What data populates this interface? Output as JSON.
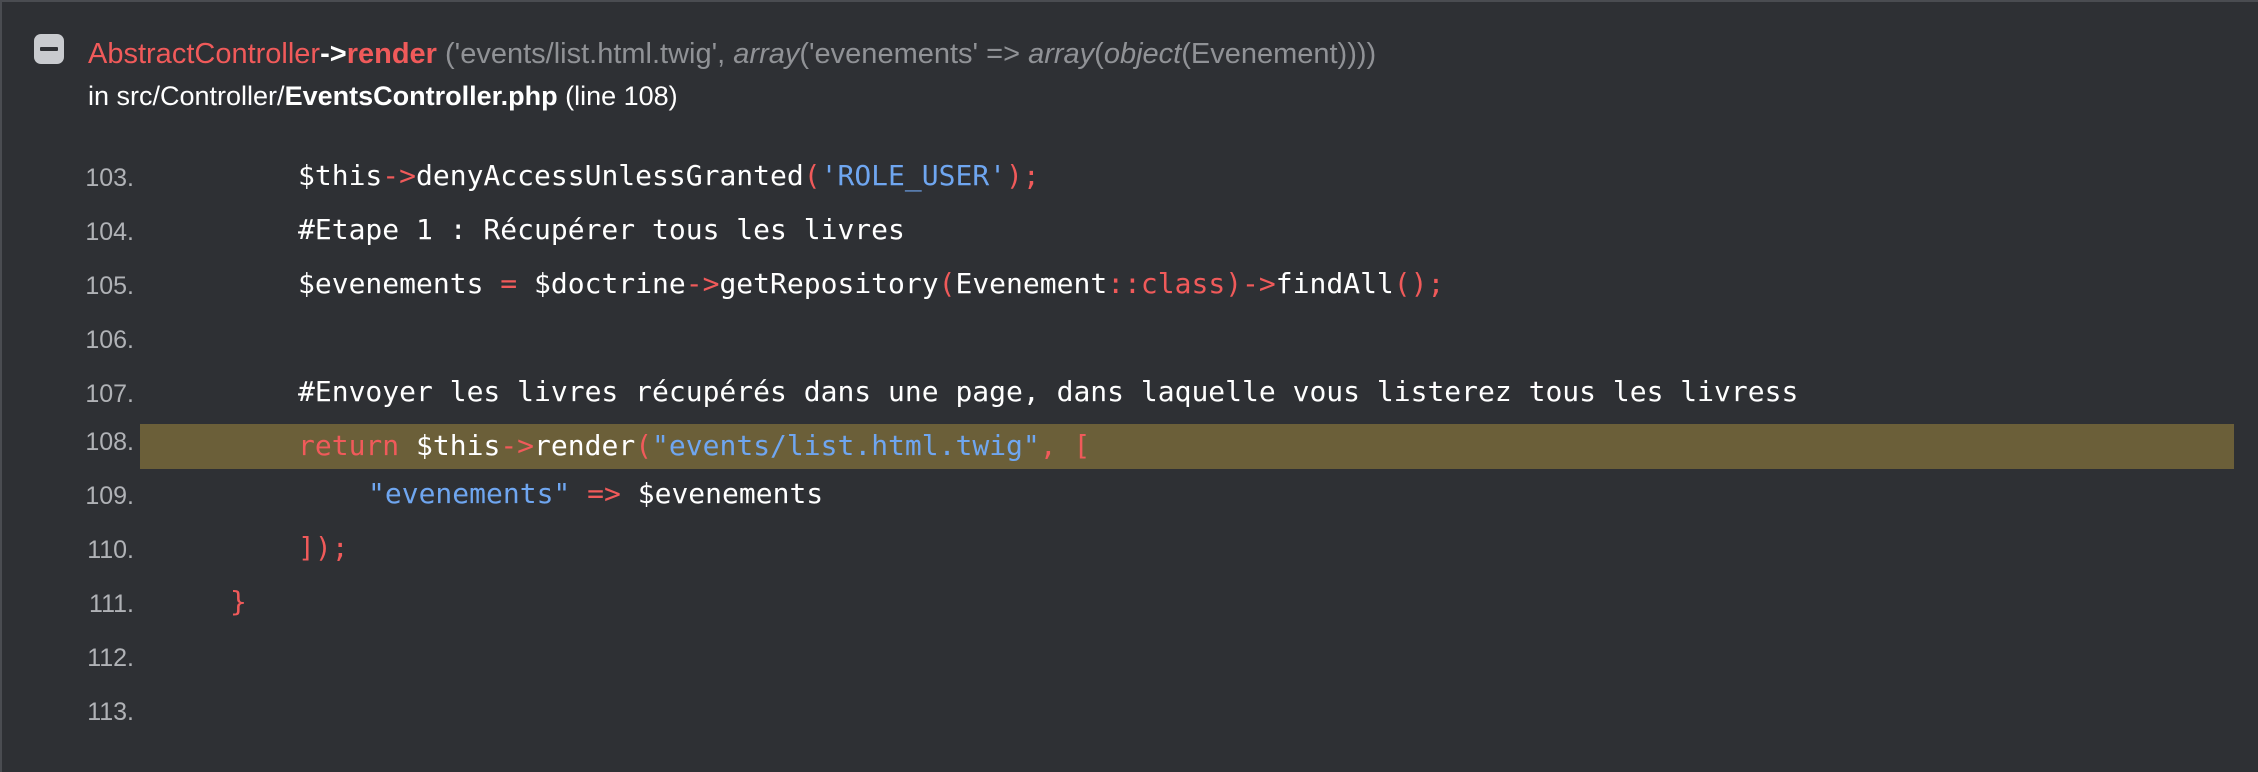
{
  "trace": {
    "class_name": "AbstractController",
    "arrow": "->",
    "method": "render",
    "args_open": " ('events/list.html.twig', ",
    "arg_array1": "array",
    "args_mid": "('evenements' => ",
    "arg_array2": "array",
    "args_paren": "(",
    "arg_object": "object",
    "args_close": "(Evenement))))",
    "file_prefix": "in src/Controller/",
    "file_name": "EventsController.php",
    "line_info": " (line 108)"
  },
  "code_lines": [
    {
      "number": "103.",
      "tokens": {
        "a": "$this",
        "b": "->",
        "c": "denyAccessUnlessGranted",
        "d": "(",
        "e": "'ROLE_USER'",
        "f": ");"
      }
    },
    {
      "number": "104.",
      "tokens": {
        "a": "#Etape 1 : Récupérer tous les livres"
      }
    },
    {
      "number": "105.",
      "tokens": {
        "a": "$evenements ",
        "b": "=",
        "c": " $doctrine",
        "d": "->",
        "e": "getRepository",
        "f": "(",
        "g": "Evenement",
        "h": "::class",
        "i": ")->",
        "j": "findAll",
        "k": "();"
      }
    },
    {
      "number": "106.",
      "tokens": {}
    },
    {
      "number": "107.",
      "tokens": {
        "a": "#Envoyer les livres récupérés dans une page, dans laquelle vous listerez tous les livress"
      }
    },
    {
      "number": "108.",
      "tokens": {
        "a": "return",
        "b": " $this",
        "c": "->",
        "d": "render",
        "e": "(",
        "f": "\"events/list.html.twig\"",
        "g": ", ["
      }
    },
    {
      "number": "109.",
      "tokens": {
        "a": "\"evenements\"",
        "b": " => ",
        "c": "$evenements"
      }
    },
    {
      "number": "110.",
      "tokens": {
        "a": "]);"
      }
    },
    {
      "number": "111.",
      "tokens": {
        "a": "}"
      }
    },
    {
      "number": "112.",
      "tokens": {}
    },
    {
      "number": "113.",
      "tokens": {}
    }
  ],
  "highlighted_line": "108.",
  "colors": {
    "background": "#2e3034",
    "highlight": "#6b5f39",
    "keyword": "#f05a5a",
    "string": "#6fa6f0",
    "text": "#ffffff",
    "muted": "#909296"
  }
}
